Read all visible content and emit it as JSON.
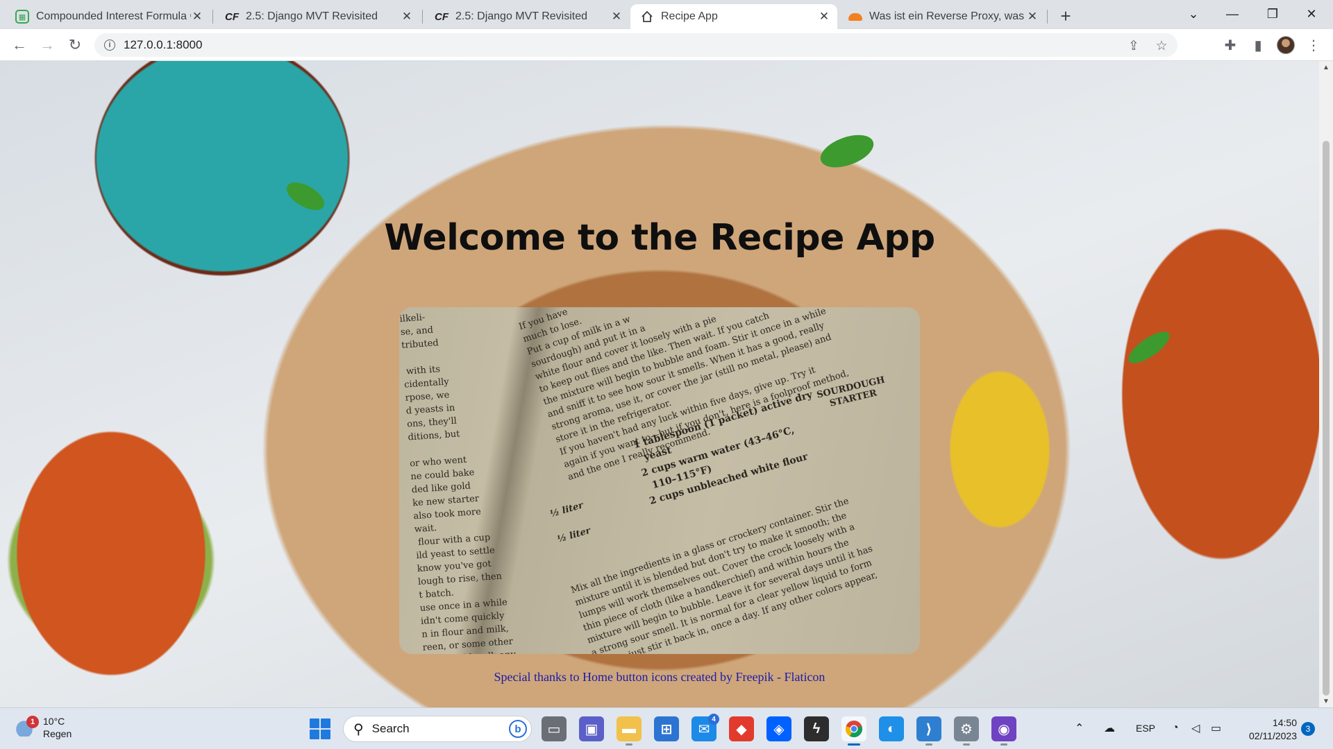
{
  "browser": {
    "tabs": [
      {
        "title": "Compounded Interest Formula C",
        "favicon": "calculator-icon",
        "active": false
      },
      {
        "title": "2.5: Django MVT Revisited",
        "favicon": "careerfoundry-icon",
        "active": false
      },
      {
        "title": "2.5: Django MVT Revisited",
        "favicon": "careerfoundry-icon",
        "active": false
      },
      {
        "title": "Recipe App",
        "favicon": "home-icon",
        "active": true
      },
      {
        "title": "Was ist ein Reverse Proxy, was is",
        "favicon": "cloudflare-icon",
        "active": false
      }
    ],
    "url": "127.0.0.1:8000"
  },
  "page": {
    "title": "Welcome to the Recipe App",
    "credits": "Special thanks to Home button icons created by Freepik - Flaticon",
    "book_image": {
      "left_column": "ilkeli-\nse, and\ntributed\n\n with its\ncidentally\nrpose, we\nd yeasts in\nons, they'll\nditions, but\n\nor who went\nne could bake\nded like gold\nke new starter\nalso took more\nwait.\n flour with a cup\nild yeast to settle\nknow you've got\nlough to rise, then\nt batch.\nuse once in a while\nidn't come quickly\nn in flour and milk,\nreen, or some other\niner would walk any\nom some kindly soul\n\nar away, the prudent\n         der all condi-",
      "right_column": "If you have\nmuch to lose.\nPut a cup of milk in a w\nsourdough) and put it in a\nwhite flour and cover it loosely with a pie\nto keep out flies and the like. Then wait. If you catch\nthe mixture will begin to bubble and foam. Stir it once in a while\nand sniff it to see how sour it smells. When it has a good, really\nstrong aroma, use it, or cover the jar (still no metal, please) and\nstore it in the refrigerator.\nIf you haven't had any luck within five days, give up. Try it\nagain if you want to—but if you don't, here is a foolproof method,\nand the one I really recommend.",
      "heading": "SOURDOUGH\nSTARTER",
      "ingredients": "1 tablespoon (1 packet) active dry\n  yeast\n2 cups warm water (43–46°C,\n  110–115°F)\n2 cups unbleached white flour",
      "measures": "½ liter\n\n½ liter",
      "method": "Mix all the ingredients in a glass or crockery container. Stir the\nmixture until it is blended but don't try to make it smooth; the\nlumps will work themselves out. Cover the crock loosely with a\nthin piece of cloth (like a handkerchief) and within hours the\nmixture will begin to bubble. Leave it for several days until it has\na strong sour smell. It is normal for a clear yellow liquid to form\non top; just stir it back in, once a day. If any other colors appear,"
    }
  },
  "taskbar": {
    "weather_temp": "10°C",
    "weather_desc": "Regen",
    "weather_badge": "1",
    "search_placeholder": "Search",
    "mail_badge": "4",
    "language": "ESP",
    "time": "14:50",
    "date": "02/11/2023",
    "notification_count": "3"
  },
  "colors": {
    "accent": "#1a1ba8",
    "taskbar": "#dfe6ef",
    "tabstrip": "#dee1e6"
  }
}
